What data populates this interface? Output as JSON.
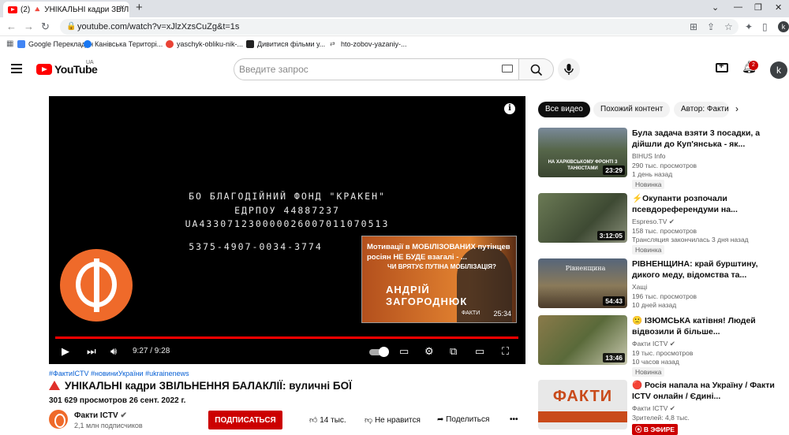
{
  "browser": {
    "tab_title": "(2) 🔺 УНІКАЛЬНІ кадри ЗВІЛЬН",
    "tab_close": "×",
    "new_tab": "+",
    "url": "youtube.com/watch?v=xJlzXzsCuZg&t=1s",
    "profile_initial": "k",
    "bookmarks": [
      {
        "label": "Google Перекладач",
        "color": "#4285f4"
      },
      {
        "label": "Канівська Територі...",
        "color": "#1877f2"
      },
      {
        "label": "yaschyk-obliku-nik-...",
        "color": "#ea4335"
      },
      {
        "label": "Дивитися фільми у...",
        "color": "#222222"
      },
      {
        "label": "hto-zobov-yazaniy-...",
        "color": "#555555"
      }
    ]
  },
  "header": {
    "logo_text": "YouTube",
    "region": "UA",
    "search_placeholder": "Введите запрос",
    "notifications_count": "2",
    "avatar_initial": "k"
  },
  "player": {
    "overlay_lines": [
      "БО БЛАГОДІЙНИЙ ФОНД \"КРАКЕН\"",
      "ЕДРПОУ 44887237",
      "UA433071230000026007011070513",
      "5375-4907-0034-3774"
    ],
    "endcard": {
      "title": "Мотивації в МОБІЛІЗОВАНИХ путінцев росіян НЕ БУДЕ взагалі - ...",
      "question": "ЧИ ВРЯТУЄ ПУТІНА МОБІЛІЗАЦІЯ?",
      "name_line1": "АНДРІЙ",
      "name_line2": "ЗАГОРОДНЮК",
      "brand": "ФАКТИ",
      "duration": "25:34"
    },
    "timecode": "9:27 / 9:28",
    "progress": 0.998
  },
  "video": {
    "hashtags": "#ФактиICTV #новиниУкраїни #ukrainenews",
    "title": "УНІКАЛЬНІ кадри ЗВІЛЬНЕННЯ БАЛАКЛІЇ: вуличні БОЇ",
    "stats": "301 629 просмотров  26 сент. 2022 г.",
    "channel": "Факти ICTV",
    "subscribers": "2,1 млн подписчиков",
    "subscribe_label": "ПОДПИСАТЬСЯ",
    "likes": "14 тыс.",
    "dislike_label": "Не нравится",
    "share_label": "Поделиться",
    "more": "•••"
  },
  "sidebar": {
    "chips": [
      "Все видео",
      "Похожий контент",
      "Автор: Факти ICTV"
    ],
    "recommendations": [
      {
        "title": "Була задача взяти 3 посадки, а дійшли до Куп'янська - як...",
        "channel": "BIHUS Info",
        "views": "290 тыс. просмотров",
        "age": "1 день назад",
        "badge": "Новинка",
        "duration": "23:29",
        "thumb_text": "НА ХАРКІВСЬКОМУ ФРОНТІ 3 ТАНКІСТАМИ",
        "thumb_color": "#5d6b4e"
      },
      {
        "title": "⚡Окупанти розпочали псевдореферендуми на...",
        "channel": "Espreso.TV",
        "views": "158 тыс. просмотров",
        "age": "Трансляция закончилась 3 дня назад",
        "badge": "Новинка",
        "duration": "3:12:05",
        "thumb_text": "",
        "thumb_color": "#4b5a3c"
      },
      {
        "title": "РІВНЕНЩИНА: край бурштину, дикого меду, відомства та...",
        "channel": "Хащі",
        "views": "196 тыс. просмотров",
        "age": "10 дней назад",
        "badge": "",
        "duration": "54:43",
        "thumb_text": "Рівненщина",
        "thumb_color": "#3c4a5a"
      },
      {
        "title": "🙁 ІЗЮМСЬКА катівня! Людей відвозили й більше...",
        "channel": "Факти ICTV",
        "views": "19 тыс. просмотров",
        "age": "10 часов назад",
        "badge": "Новинка",
        "duration": "13:46",
        "thumb_text": "",
        "thumb_color": "#6b5a3a"
      },
      {
        "title": "🔴 Росія напала на Україну / Факти ICTV онлайн / Єдині...",
        "channel": "Факти ICTV",
        "views": "Зрителей: 4,8 тыс.",
        "age": "",
        "badge": "В ЭФИРЕ",
        "duration": "",
        "thumb_text": "ФАКТИ",
        "thumb_color": "#e0e0e0"
      }
    ]
  }
}
